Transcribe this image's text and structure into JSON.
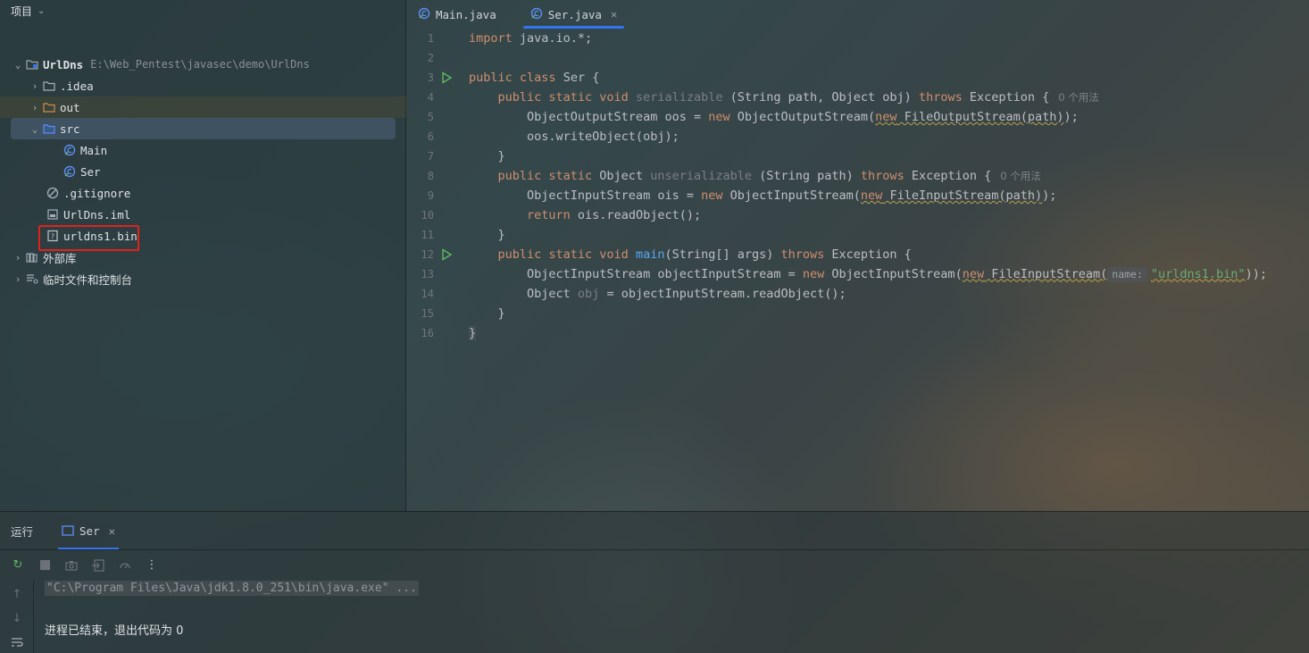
{
  "project_panel": {
    "title": "项目",
    "root": {
      "name": "UrlDns",
      "path": "E:\\Web_Pentest\\javasec\\demo\\UrlDns"
    },
    "items": [
      {
        "label": ".idea"
      },
      {
        "label": "out"
      },
      {
        "label": "src"
      },
      {
        "label": "Main"
      },
      {
        "label": "Ser"
      },
      {
        "label": ".gitignore"
      },
      {
        "label": "UrlDns.iml"
      },
      {
        "label": "urldns1.bin"
      },
      {
        "label": "外部库"
      },
      {
        "label": "临时文件和控制台"
      }
    ]
  },
  "tabs": [
    {
      "label": "Main.java"
    },
    {
      "label": "Ser.java"
    }
  ],
  "editor": {
    "line_numbers": [
      "1",
      "2",
      "3",
      "4",
      "5",
      "6",
      "7",
      "8",
      "9",
      "10",
      "11",
      "12",
      "13",
      "14",
      "15",
      "16"
    ],
    "code": {
      "l1_import": "import",
      "l1_rest": " java.io.*;",
      "l3_public": "public",
      "l3_class": " class",
      "l3_rest": " Ser {",
      "l4_mods": "    public static void",
      "l4_name": " serializable",
      "l4_params": " (String path, Object obj)",
      "l4_throws": " throws",
      "l4_rest": " Exception {",
      "l4_hint": "0 个用法",
      "l5_a": "        ObjectOutputStream oos = ",
      "l5_new": "new",
      "l5_b": " ObjectOutputStream(",
      "l5_new2": "new",
      "l5_c": " FileOutputStream(path)",
      "l5_d": ");",
      "l6": "        oos.writeObject(obj);",
      "l7": "    }",
      "l8_mods": "    public static",
      "l8_type": " Object",
      "l8_name": " unserializable",
      "l8_params": " (String path)",
      "l8_throws": " throws",
      "l8_rest": " Exception {",
      "l8_hint": "0 个用法",
      "l9_a": "        ObjectInputStream ois = ",
      "l9_new": "new",
      "l9_b": " ObjectInputStream(",
      "l9_new2": "new",
      "l9_c": " FileInputStream(path)",
      "l9_d": ");",
      "l10_ret": "        return",
      "l10_rest": " ois.readObject();",
      "l11": "    }",
      "l12_mods": "    public static void",
      "l12_name": " main",
      "l12_params": "(String[] args)",
      "l12_throws": " throws",
      "l12_rest": " Exception {",
      "l13_a": "        ObjectInputStream objectInputStream = ",
      "l13_new": "new",
      "l13_b": " ObjectInputStream(",
      "l13_new2": "new",
      "l13_c": " FileInputStream(",
      "l13_inlay": "name:",
      "l13_str": "\"urldns1.bin\"",
      "l13_d": "));",
      "l14_a": "        Object ",
      "l14_var": "obj",
      "l14_b": " = objectInputStream.readObject();",
      "l15": "    }",
      "l16": "}"
    }
  },
  "run_panel": {
    "title": "运行",
    "tab": "Ser",
    "command": "\"C:\\Program Files\\Java\\jdk1.8.0_251\\bin\\java.exe\" ...",
    "exit_message": "进程已结束，退出代码为 0"
  }
}
